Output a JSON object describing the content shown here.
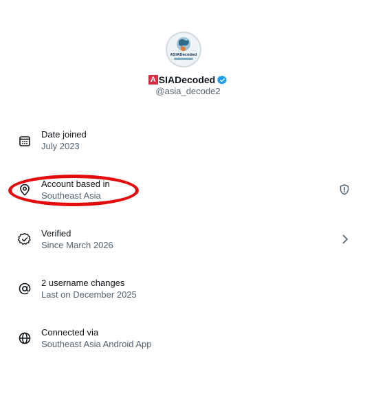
{
  "profile": {
    "avatar_text": "ASIADecoded",
    "name_badge_letter": "A",
    "name_rest": "SIADecoded",
    "handle": "@asia_decode2"
  },
  "rows": [
    {
      "title": "Date joined",
      "subtitle": "July 2023",
      "icon": "calendar-icon"
    },
    {
      "title": "Account based in",
      "subtitle": "Southeast Asia",
      "icon": "location-pin-icon",
      "right_icon": "shield-icon"
    },
    {
      "title": "Verified",
      "subtitle": "Since March 2026",
      "icon": "verified-badge-icon",
      "right_icon": "chevron-right-icon"
    },
    {
      "title": "2 username changes",
      "subtitle": "Last on December 2025",
      "icon": "at-sign-icon"
    },
    {
      "title": "Connected via",
      "subtitle": "Southeast Asia Android App",
      "icon": "globe-icon"
    }
  ],
  "colors": {
    "primary_text": "#0f1419",
    "secondary_text": "#536471",
    "verified_blue": "#1d9bf0",
    "annotation_red": "#e30b0b",
    "badge_red": "#d32f45"
  }
}
